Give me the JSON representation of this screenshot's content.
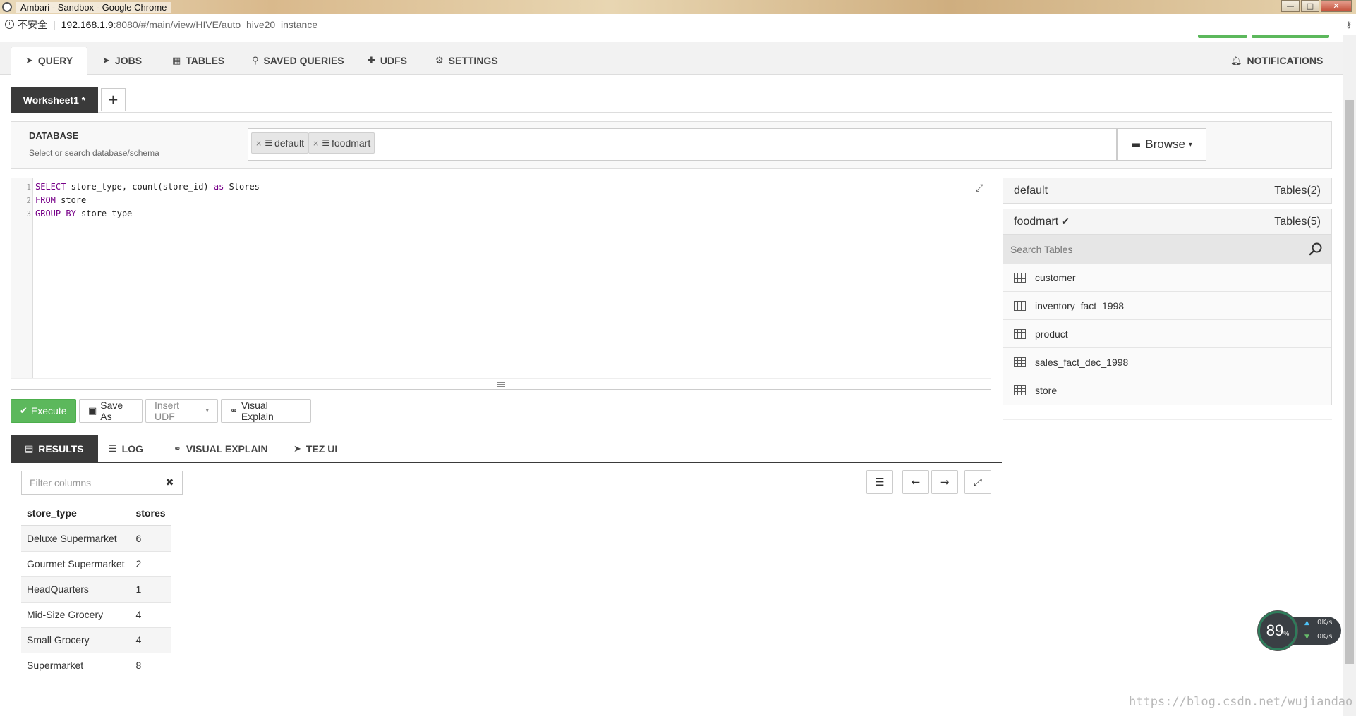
{
  "window": {
    "title": "Ambari - Sandbox - Google Chrome",
    "buttons": {
      "minimize": "—",
      "maximize": "□",
      "close": "✕"
    }
  },
  "addressbar": {
    "security_label": "不安全",
    "url_host": "192.168.1.9",
    "url_rest": ":8080/#/main/view/HIVE/auto_hive20_instance"
  },
  "colors": {
    "accent_green": "#5cb85c",
    "dark_tab": "#3a3a3a"
  },
  "topnav": {
    "tabs": [
      {
        "label": "QUERY",
        "icon": "paper-plane-icon"
      },
      {
        "label": "JOBS",
        "icon": "paper-plane-icon"
      },
      {
        "label": "TABLES",
        "icon": "table-icon"
      },
      {
        "label": "SAVED QUERIES",
        "icon": "paperclip-icon"
      },
      {
        "label": "UDFs",
        "icon": "puzzle-icon"
      },
      {
        "label": "SETTINGS",
        "icon": "gear-icon"
      }
    ],
    "notifications_label": "NOTIFICATIONS"
  },
  "worksheets": {
    "tabs": [
      {
        "label": "Worksheet1 *"
      }
    ],
    "add_label": "+"
  },
  "database": {
    "label": "DATABASE",
    "hint": "Select or search database/schema",
    "chips": [
      {
        "label": "default"
      },
      {
        "label": "foodmart"
      }
    ],
    "browse_label": "Browse"
  },
  "editor": {
    "lines": [
      {
        "num": "1",
        "parts": [
          {
            "t": "SELECT",
            "kw": true
          },
          {
            "t": " store_type, count(store_id) "
          },
          {
            "t": "as",
            "kw": true
          },
          {
            "t": " Stores"
          }
        ]
      },
      {
        "num": "2",
        "parts": [
          {
            "t": "FROM",
            "kw": true
          },
          {
            "t": " store"
          }
        ]
      },
      {
        "num": "3",
        "parts": [
          {
            "t": "GROUP BY",
            "kw": true
          },
          {
            "t": " store_type"
          }
        ]
      }
    ]
  },
  "actions": {
    "execute": "Execute",
    "save_as": "Save As",
    "insert_udf": "Insert UDF",
    "visual_explain": "Visual Explain"
  },
  "result_tabs": [
    {
      "label": "RESULTS",
      "icon": "file-text-icon"
    },
    {
      "label": "LOG",
      "icon": "list-icon"
    },
    {
      "label": "VISUAL EXPLAIN",
      "icon": "link-icon"
    },
    {
      "label": "TEZ UI",
      "icon": "paper-plane-icon"
    }
  ],
  "filter": {
    "placeholder": "Filter columns"
  },
  "results": {
    "columns": [
      "store_type",
      "stores"
    ],
    "rows": [
      [
        "Deluxe Supermarket",
        "6"
      ],
      [
        "Gourmet Supermarket",
        "2"
      ],
      [
        "HeadQuarters",
        "1"
      ],
      [
        "Mid-Size Grocery",
        "4"
      ],
      [
        "Small Grocery",
        "4"
      ],
      [
        "Supermarket",
        "8"
      ]
    ]
  },
  "sidebar": {
    "databases": [
      {
        "name": "default",
        "tables": "Tables(2)"
      },
      {
        "name": "foodmart",
        "tables": "Tables(5)",
        "selected": true
      }
    ],
    "search_placeholder": "Search Tables",
    "tables": [
      "customer",
      "inventory_fact_1998",
      "product",
      "sales_fact_dec_1998",
      "store"
    ]
  },
  "network_widget": {
    "percent": "89",
    "percent_unit": "%",
    "up_rate": "0K/s",
    "down_rate": "0K/s"
  },
  "watermark": "https://blog.csdn.net/wujiandao"
}
